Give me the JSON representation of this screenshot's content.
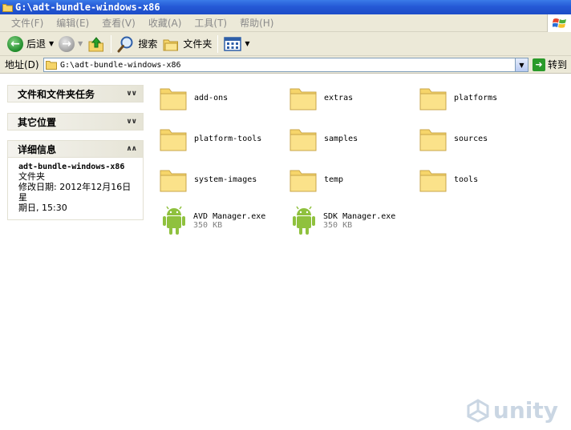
{
  "window": {
    "title": "G:\\adt-bundle-windows-x86"
  },
  "menu": {
    "items": [
      "文件(F)",
      "编辑(E)",
      "查看(V)",
      "收藏(A)",
      "工具(T)",
      "帮助(H)"
    ]
  },
  "toolbar": {
    "back_label": "后退",
    "search_label": "搜索",
    "folders_label": "文件夹"
  },
  "address": {
    "label": "地址(D)",
    "value": "G:\\adt-bundle-windows-x86",
    "go_label": "转到"
  },
  "taskpane": {
    "file_tasks": "文件和文件夹任务",
    "other_places": "其它位置",
    "details": {
      "title": "详细信息",
      "name": "adt-bundle-windows-x86",
      "type": "文件夹",
      "modified_line1": "修改日期: 2012年12月16日星",
      "modified_line2": "期日, 15:30"
    }
  },
  "files": {
    "folders": [
      "add-ons",
      "extras",
      "platforms",
      "platform-tools",
      "samples",
      "sources",
      "system-images",
      "temp",
      "tools"
    ],
    "exes": [
      {
        "name": "AVD Manager.exe",
        "size": "350 KB"
      },
      {
        "name": "SDK Manager.exe",
        "size": "350 KB"
      }
    ]
  },
  "watermark": {
    "text": "unity"
  },
  "colors": {
    "titlebar": "#2559d6",
    "chrome": "#ece9d8",
    "folder": "#f6d56a",
    "android": "#8fc13e"
  }
}
